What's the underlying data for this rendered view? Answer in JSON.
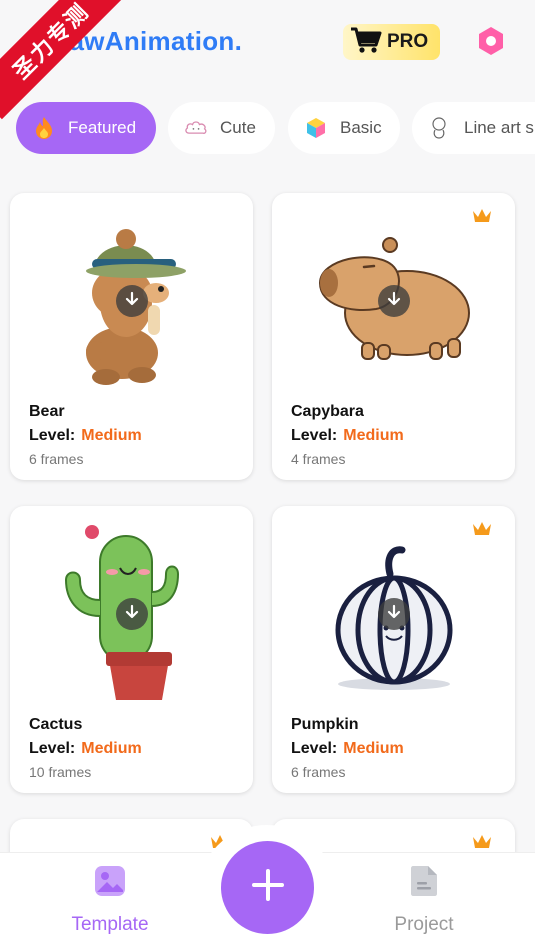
{
  "header": {
    "app_title": "DrawAnimation.",
    "pro_label": "PRO",
    "corner_ribbon": "圣力专测"
  },
  "chips": [
    {
      "label": "Featured",
      "icon": "fire-icon",
      "active": true
    },
    {
      "label": "Cute",
      "icon": "cloud-icon",
      "active": false
    },
    {
      "label": "Basic",
      "icon": "cube-icon",
      "active": false
    },
    {
      "label": "Line art s",
      "icon": "sketch-icon",
      "active": false
    }
  ],
  "cards": [
    {
      "name": "Bear",
      "level_label": "Level:",
      "level": "Medium",
      "frames": "6 frames",
      "premium": false
    },
    {
      "name": "Capybara",
      "level_label": "Level:",
      "level": "Medium",
      "frames": "4 frames",
      "premium": true
    },
    {
      "name": "Cactus",
      "level_label": "Level:",
      "level": "Medium",
      "frames": "10 frames",
      "premium": false
    },
    {
      "name": "Pumpkin",
      "level_label": "Level:",
      "level": "Medium",
      "frames": "6 frames",
      "premium": true
    }
  ],
  "bottom_nav": {
    "template_label": "Template",
    "project_label": "Project"
  },
  "colors": {
    "accent": "#a667f5",
    "title_blue": "#2f7cf6",
    "level_orange": "#f26a1b",
    "ribbon_red": "#e0102a"
  }
}
